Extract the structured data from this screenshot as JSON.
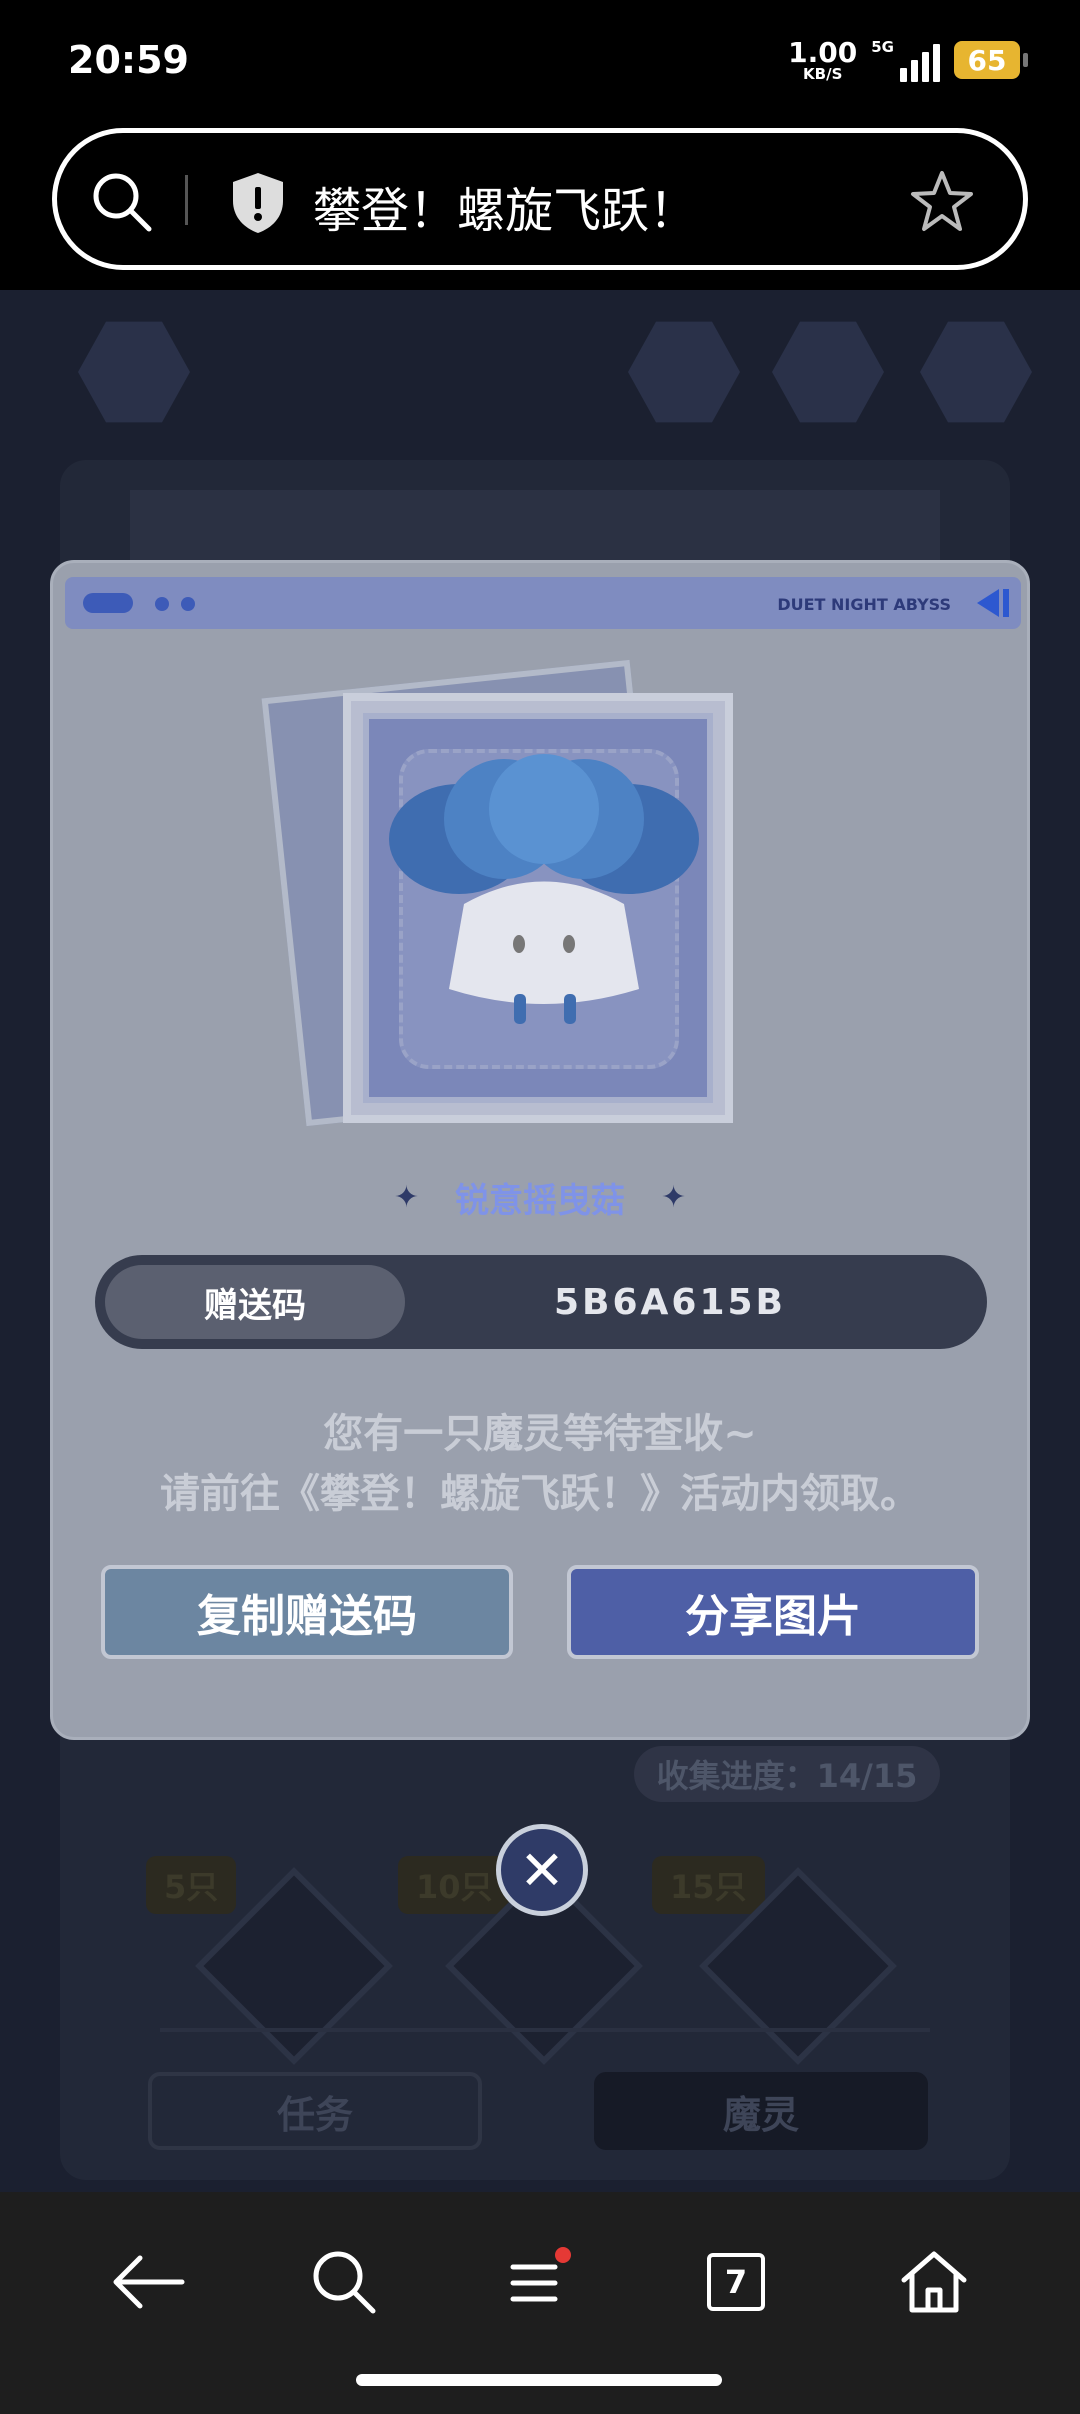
{
  "status_bar": {
    "time": "20:59",
    "net_speed_value": "1.00",
    "net_speed_unit": "KB/S",
    "network": "5G",
    "battery": "65"
  },
  "url_bar": {
    "title": "攀登！螺旋飞跃！",
    "icons": [
      "search-icon",
      "shield-icon",
      "star-icon"
    ]
  },
  "game": {
    "progress_text": "收集进度：14/15",
    "milestones": [
      "5只",
      "10只",
      "15只"
    ],
    "tabs": [
      "任务",
      "魔灵"
    ]
  },
  "dialog": {
    "brand": "DUET NIGHT ABYSS",
    "card_name": "锐意摇曳菇",
    "code_label": "赠送码",
    "code_value": "5B6A615B",
    "message_line1": "您有一只魔灵等待查收~",
    "message_line2": "请前往《攀登！螺旋飞跃！》活动内领取。",
    "copy_button": "复制赠送码",
    "share_button": "分享图片",
    "close_glyph": "✕"
  },
  "bottom_nav": {
    "tab_count": "7",
    "icons": [
      "back-icon",
      "search-icon",
      "menu-icon",
      "tabs-icon",
      "home-icon"
    ]
  },
  "colors": {
    "accent_blue": "#4e5fa6",
    "copy_button": "#6c86a1",
    "battery": "#e7b530",
    "notification_dot": "#e53935"
  }
}
